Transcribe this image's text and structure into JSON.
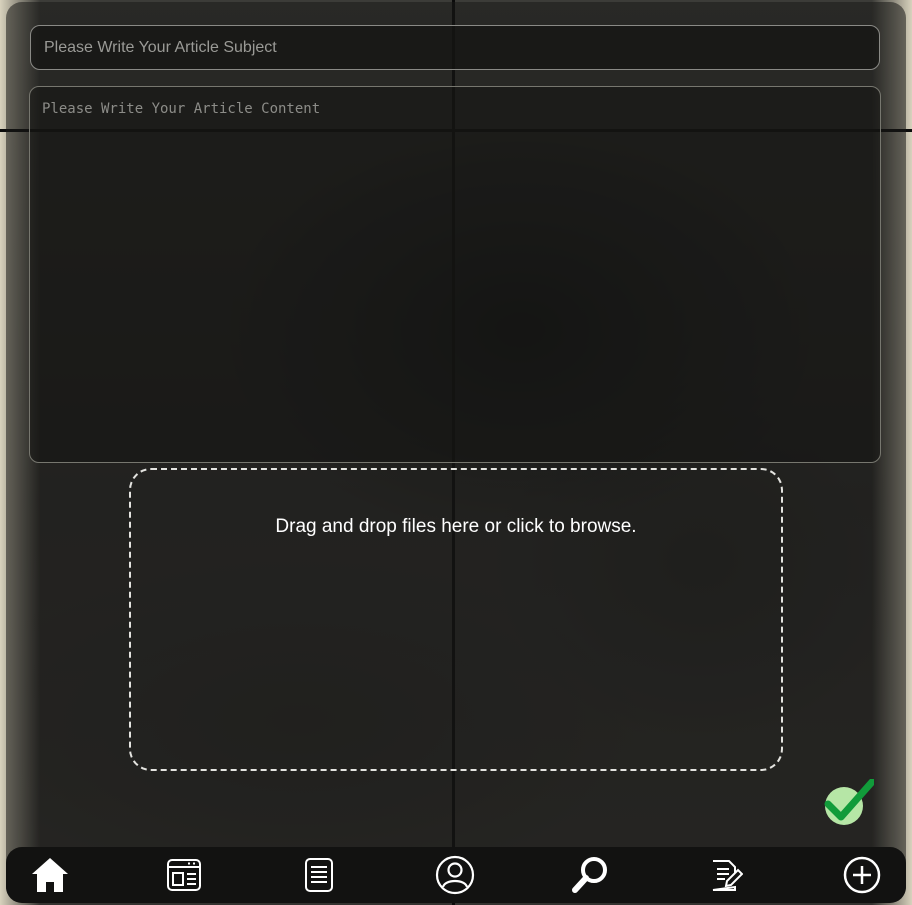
{
  "form": {
    "subject_placeholder": "Please Write Your Article Subject",
    "content_placeholder": "Please Write Your Article Content",
    "dropzone_text": "Drag and drop files here or click to browse."
  },
  "confirm": {
    "icon": "checkmark-icon",
    "color": "#119b3a",
    "circle_color": "#b6e6a6"
  },
  "navbar": {
    "items": [
      {
        "name": "home",
        "icon": "home-icon"
      },
      {
        "name": "articles",
        "icon": "browser-layout-icon"
      },
      {
        "name": "list",
        "icon": "document-list-icon"
      },
      {
        "name": "profile",
        "icon": "user-circle-icon"
      },
      {
        "name": "search",
        "icon": "search-icon"
      },
      {
        "name": "write",
        "icon": "edit-document-icon"
      },
      {
        "name": "add",
        "icon": "add-circle-icon"
      }
    ]
  },
  "colors": {
    "nav_background": "#121211",
    "icon": "#ffffff"
  }
}
